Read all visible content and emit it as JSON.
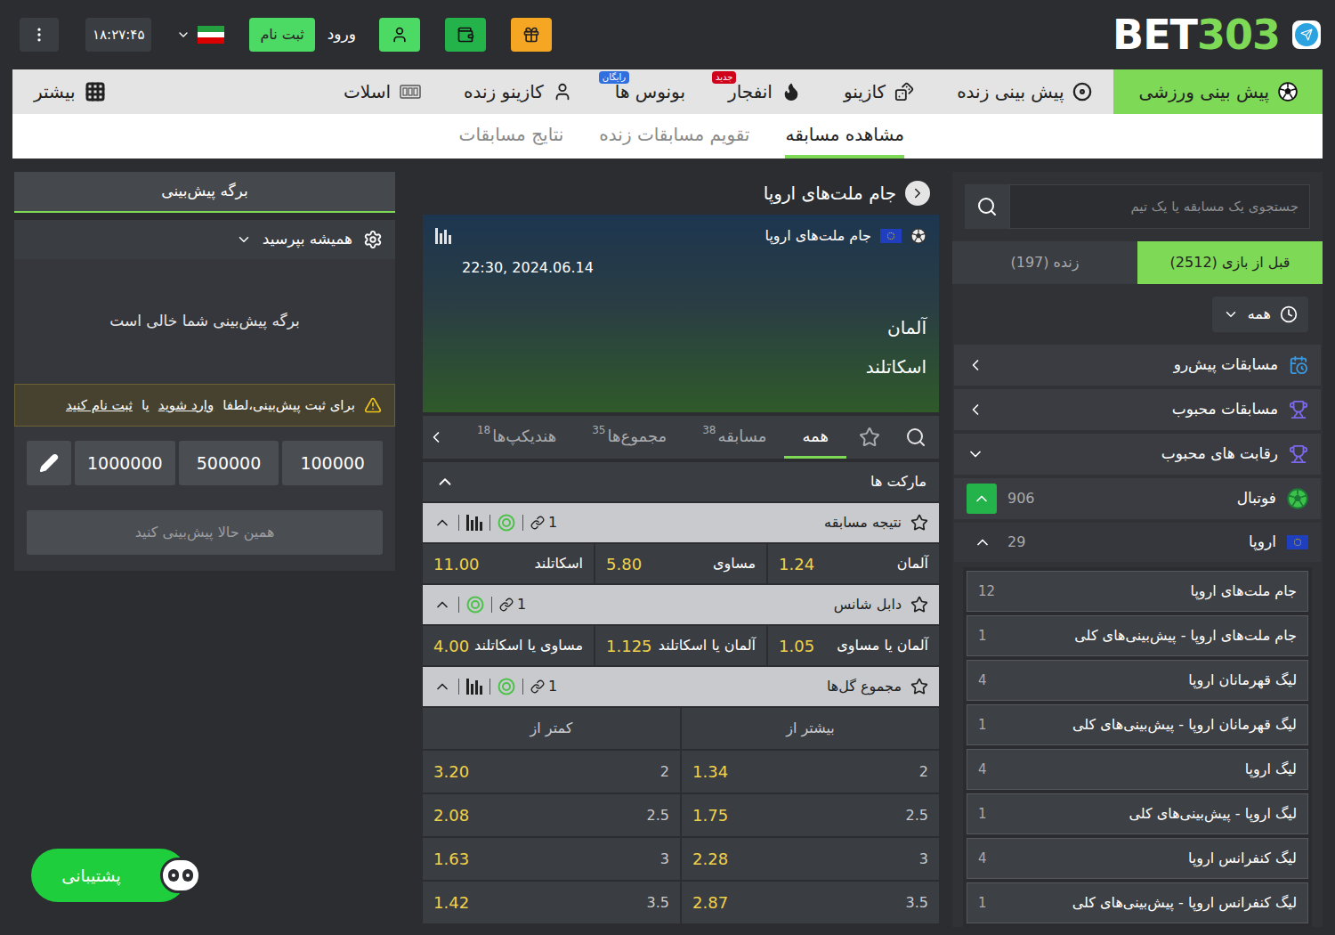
{
  "header": {
    "logo": [
      "BET",
      "303"
    ],
    "time": "۱۸:۲۷:۴۵",
    "register": "ثبت نام",
    "login": "ورود"
  },
  "nav": [
    {
      "label": "پیش بینی ورزشی",
      "selected": true
    },
    {
      "label": "پیش بینی زنده",
      "selected": false
    },
    {
      "label": "کازینو",
      "selected": false
    },
    {
      "label": "انفجار",
      "selected": false,
      "badge": "جدید",
      "badge_color": "#d0021b"
    },
    {
      "label": "بونوس ها",
      "selected": false,
      "badge": "رایگان",
      "badge_color": "#2f6fe0"
    },
    {
      "label": "کازینو زنده",
      "selected": false
    },
    {
      "label": "اسلات",
      "selected": false
    }
  ],
  "more": "بیشتر",
  "subnav": [
    {
      "label": "مشاهده مسابقه",
      "selected": true
    },
    {
      "label": "تقویم مسابقات زنده",
      "selected": false
    },
    {
      "label": "نتایج مسابقات",
      "selected": false
    }
  ],
  "sidebar": {
    "search": {
      "placeholder": "جستجوی یک مسابقه یا یک تیم"
    },
    "tabs": [
      {
        "label": "قبل از بازی (2512)",
        "selected": true
      },
      {
        "label": "زنده (197)",
        "selected": false
      }
    ],
    "filter": {
      "label": "همه",
      "expanded": false
    },
    "sections": [
      {
        "label": "مسابقات پیش‌رو",
        "expanded": false
      },
      {
        "label": "مسابقات محبوب",
        "expanded": false
      },
      {
        "label": "رقابت های محبوب",
        "expanded": true
      }
    ],
    "sport": {
      "label": "فوتبال",
      "count": "906",
      "expanded": true
    },
    "region": {
      "label": "اروپا",
      "count": "29",
      "expanded": true
    },
    "leagues": [
      {
        "label": "جام ملت‌های اروپا",
        "count": "12"
      },
      {
        "label": "جام ملت‌های اروپا - پیش‌بینی‌های کلی",
        "count": "1"
      },
      {
        "label": "لیگ قهرمانان اروپا",
        "count": "4"
      },
      {
        "label": "لیگ قهرمانان اروپا - پیش‌بینی‌های کلی",
        "count": "1"
      },
      {
        "label": "لیگ اروپا",
        "count": "4"
      },
      {
        "label": "لیگ اروپا - پیش‌بینی‌های کلی",
        "count": "1"
      },
      {
        "label": "لیگ کنفرانس اروپا",
        "count": "4"
      },
      {
        "label": "لیگ کنفرانس اروپا - پیش‌بینی‌های کلی",
        "count": "1"
      }
    ]
  },
  "event": {
    "title": "جام ملت‌های اروپا",
    "banner": {
      "competition": "جام ملت‌های اروپا",
      "datetime": "22:30, 2024.06.14",
      "home": "آلمان",
      "away": "اسکاتلند"
    },
    "tabs": [
      {
        "label": "همه",
        "selected": true
      },
      {
        "label": "مسابقه",
        "count": "38",
        "selected": false
      },
      {
        "label": "مجموع‌ها",
        "count": "35",
        "selected": false
      },
      {
        "label": "هندیکپ‌ها",
        "count": "18",
        "selected": false
      }
    ],
    "markets_title": "مارکت ها",
    "markets_expanded": true,
    "markets": [
      {
        "kind": "row",
        "title": "نتیجه مسابقه",
        "links": "1",
        "stats": true,
        "expanded": true,
        "outcomes": [
          {
            "label": "آلمان",
            "odds": "1.24"
          },
          {
            "label": "مساوی",
            "odds": "5.80"
          },
          {
            "label": "اسکاتلند",
            "odds": "11.00"
          }
        ]
      },
      {
        "kind": "row",
        "title": "دابل شانس",
        "links": "1",
        "stats": false,
        "expanded": true,
        "outcomes": [
          {
            "label": "آلمان یا مساوی",
            "odds": "1.05"
          },
          {
            "label": "آلمان یا اسکاتلند",
            "odds": "1.125"
          },
          {
            "label": "مساوی یا اسکاتلند",
            "odds": "4.00"
          }
        ]
      },
      {
        "kind": "table",
        "title": "مجموع گل‌ها",
        "links": "1",
        "stats": true,
        "expanded": true,
        "columns": [
          "بیشتر از",
          "کمتر از"
        ],
        "rows": [
          [
            {
              "line": "2",
              "odds": "1.34"
            },
            {
              "line": "2",
              "odds": "3.20"
            }
          ],
          [
            {
              "line": "2.5",
              "odds": "1.75"
            },
            {
              "line": "2.5",
              "odds": "2.08"
            }
          ],
          [
            {
              "line": "3",
              "odds": "2.28"
            },
            {
              "line": "3",
              "odds": "1.63"
            }
          ],
          [
            {
              "line": "3.5",
              "odds": "2.87"
            },
            {
              "line": "3.5",
              "odds": "1.42"
            }
          ]
        ]
      }
    ]
  },
  "betslip": {
    "title": "برگه پیش‌بینی",
    "accept": {
      "label": "همیشه بپرسید",
      "expanded": false
    },
    "empty": "برگه پیش‌بینی شما خالی است",
    "warning": {
      "prefix": "برای ثبت پیش‌بینی،لطفا",
      "login": "وارد شوید",
      "or": "یا",
      "register": "ثبت نام کنید"
    },
    "stakes": [
      "100000",
      "500000",
      "1000000"
    ],
    "submit": {
      "label": "همین حالا پیش‌بینی کنید",
      "disabled": true
    }
  },
  "support": "پشتیبانی"
}
